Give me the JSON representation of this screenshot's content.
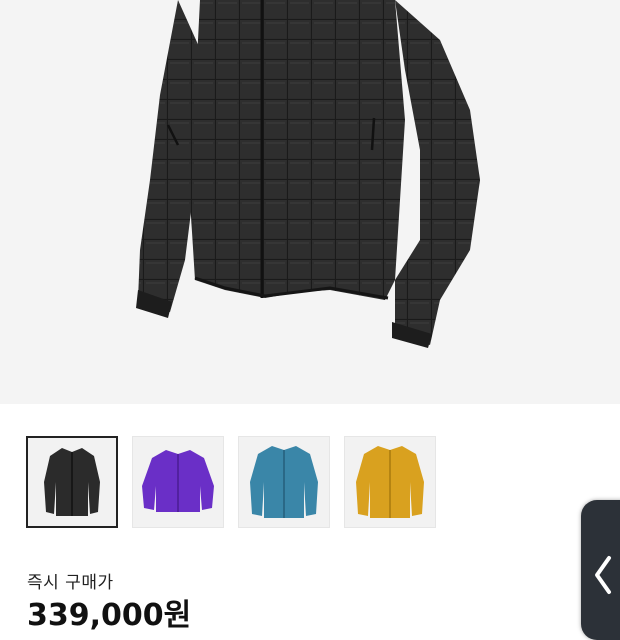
{
  "product": {
    "main_image": "black-quilted-jacket",
    "thumbnails": [
      {
        "name": "black",
        "color": "#2b2b2b",
        "selected": true
      },
      {
        "name": "purple",
        "color": "#6a2fc7",
        "selected": false
      },
      {
        "name": "blue",
        "color": "#3a86a8",
        "selected": false
      },
      {
        "name": "yellow",
        "color": "#d9a11f",
        "selected": false
      }
    ]
  },
  "purchase": {
    "label": "즉시 구매가",
    "price": "339,000원"
  },
  "side_panel": {
    "icon": "chevron-left-icon"
  }
}
